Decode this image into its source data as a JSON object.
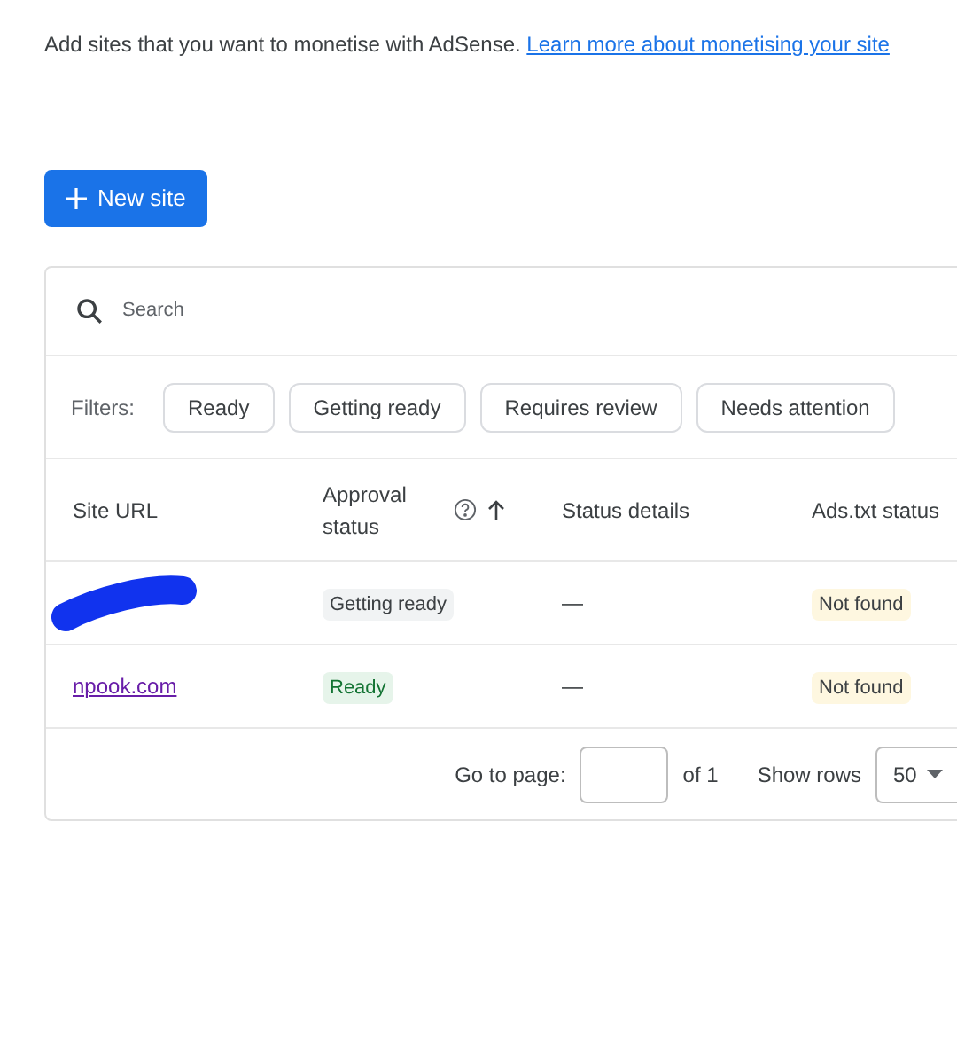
{
  "intro": {
    "text": "Add sites that you want to monetise with AdSense.",
    "link": "Learn more about monetising your site"
  },
  "new_site_button": {
    "label": "New site"
  },
  "search": {
    "placeholder": "Search"
  },
  "filters": {
    "label": "Filters:",
    "chips": [
      {
        "label": "Ready",
        "selected": false
      },
      {
        "label": "Getting ready",
        "selected": false
      },
      {
        "label": "Requires review",
        "selected": false
      },
      {
        "label": "Needs attention",
        "selected": false
      }
    ]
  },
  "table": {
    "columns": [
      {
        "label": "Site URL"
      },
      {
        "label": "Approval status",
        "help": true,
        "sorted": true
      },
      {
        "label": "Status details"
      },
      {
        "label": "Ads.txt status"
      }
    ],
    "rows": [
      {
        "redacted": true,
        "approval": {
          "label": "Getting ready",
          "kind": "pending"
        },
        "details": "—",
        "ads_txt": {
          "label": "Not found",
          "kind": "warning"
        }
      },
      {
        "redacted": false,
        "site": "npook.com",
        "approval": {
          "label": "Ready",
          "kind": "ready"
        },
        "details": "—",
        "ads_txt": {
          "label": "Not found",
          "kind": "warning"
        }
      }
    ]
  },
  "pagination": {
    "go_to_label": "Go to page:",
    "of_label": "of 1",
    "rows_label": "Show rows",
    "rows_value": "50"
  }
}
